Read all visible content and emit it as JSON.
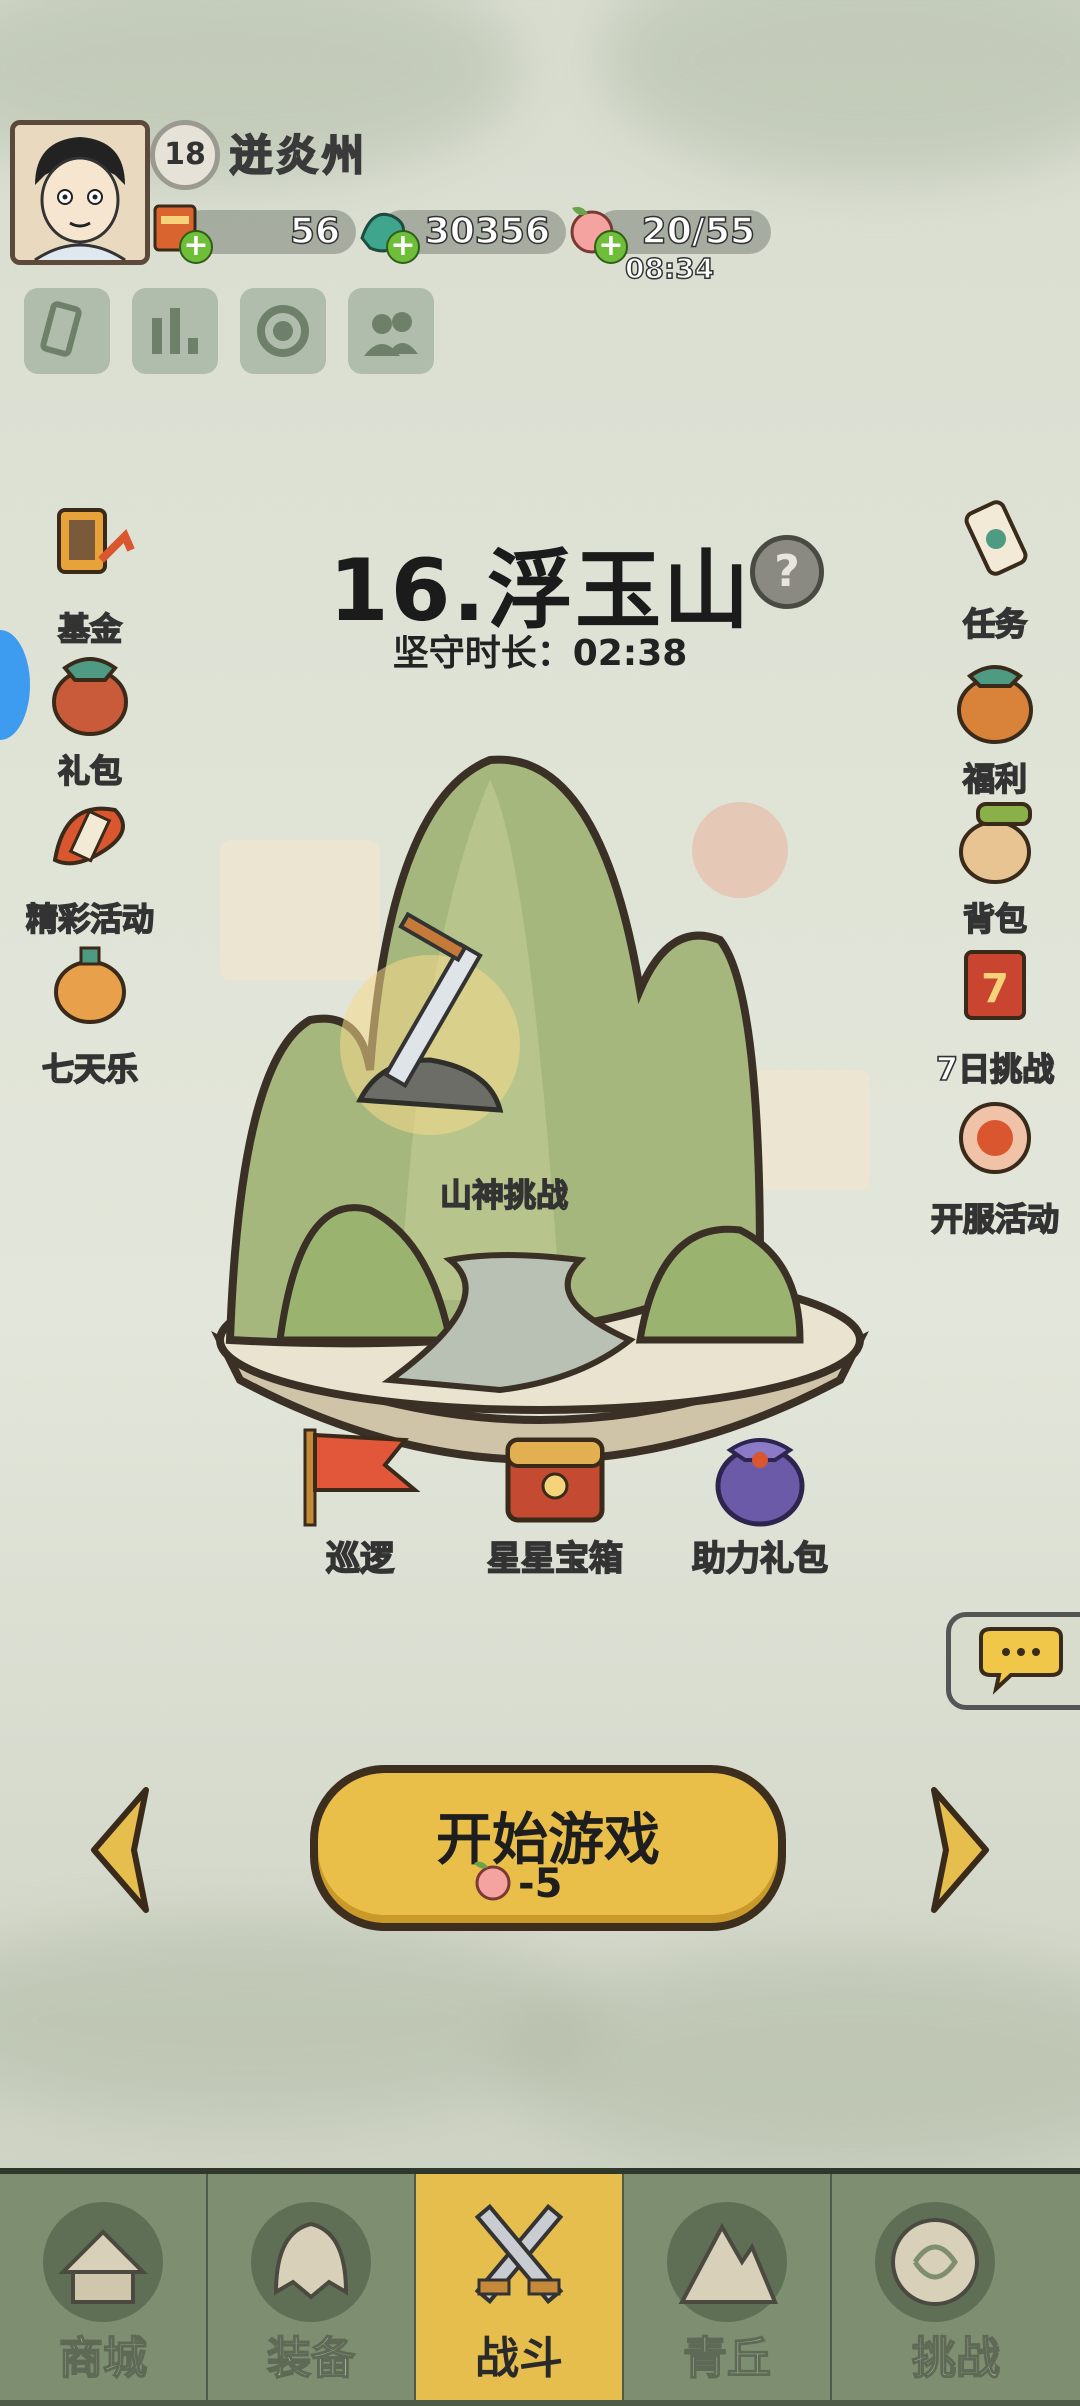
{
  "player": {
    "level": "18",
    "name": "迸炎州"
  },
  "resources": {
    "coupon": "56",
    "jade": "30356",
    "stamina": "20/55",
    "stamina_timer": "08:34"
  },
  "stage": {
    "title": "16.浮玉山",
    "help": "?",
    "hold_time": "坚守时长：02:38"
  },
  "left_menu": [
    "基金",
    "礼包",
    "精彩活动",
    "七天乐"
  ],
  "right_menu": [
    "任务",
    "福利",
    "背包",
    "7日挑战",
    "开服活动"
  ],
  "map": {
    "challenge_label": "山神挑战"
  },
  "map_items": [
    "巡逻",
    "星星宝箱",
    "助力礼包"
  ],
  "start": {
    "label": "开始游戏",
    "cost": "-5"
  },
  "tabs": [
    "商城",
    "装备",
    "战斗",
    "青丘",
    "挑战"
  ],
  "active_tab": "战斗",
  "colors": {
    "accent": "#e6be4e",
    "tabbar": "#4e5b46",
    "tab": "#7d8f70"
  }
}
